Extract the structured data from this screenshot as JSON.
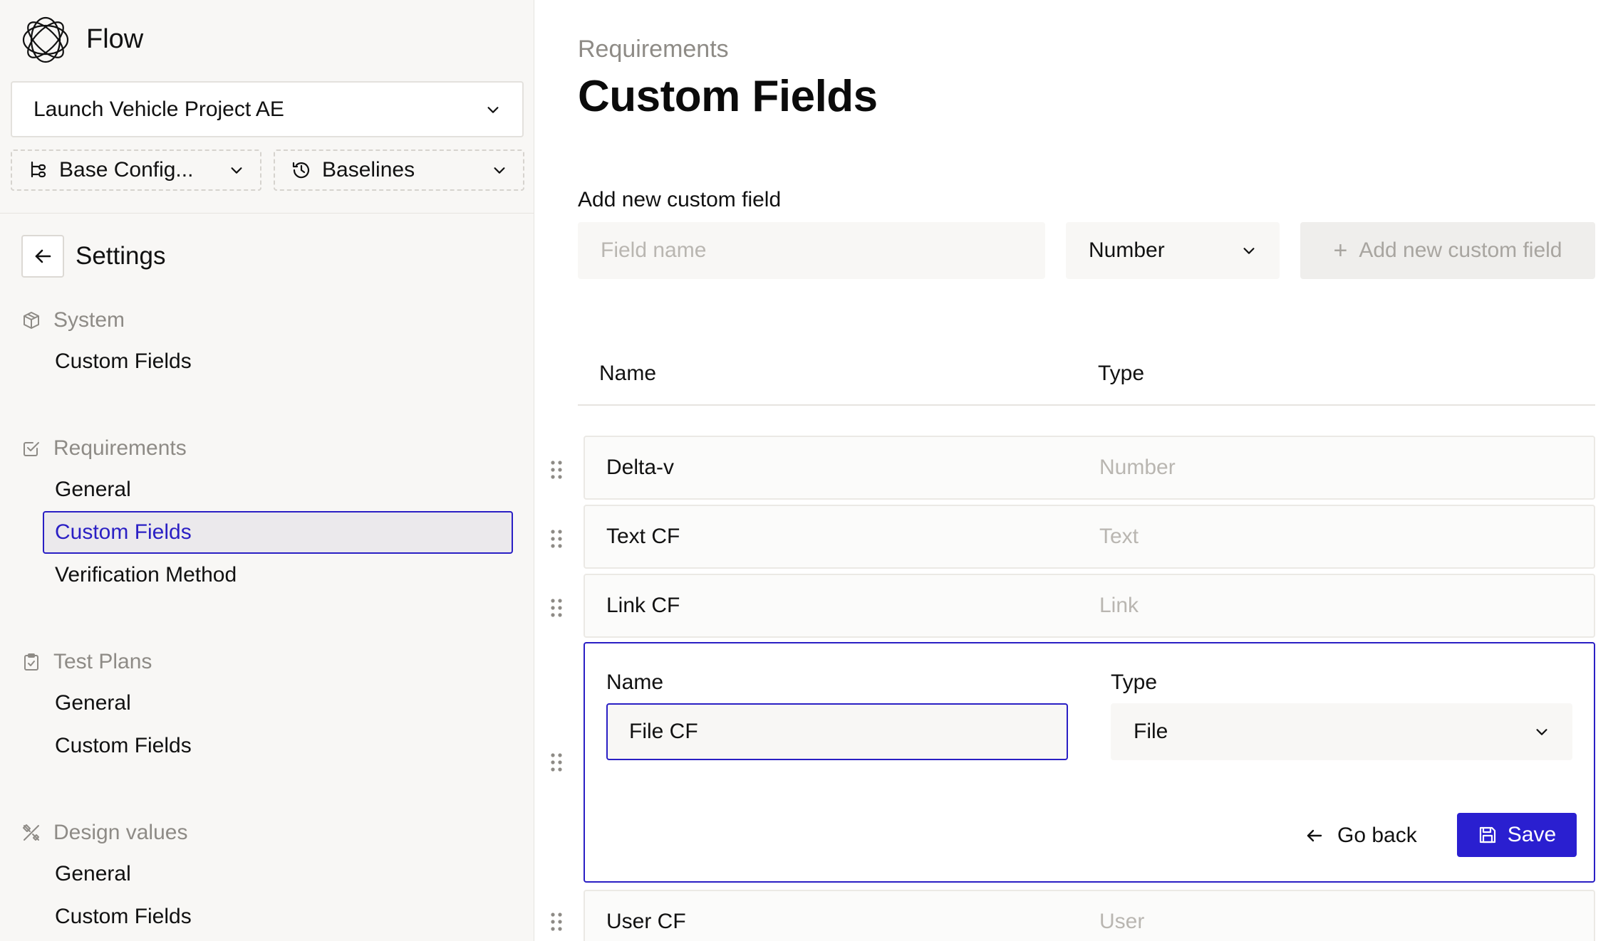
{
  "app": {
    "title": "Flow"
  },
  "sidebar": {
    "project_select": {
      "value": "Launch Vehicle Project AE"
    },
    "config_select": {
      "value": "Base Config..."
    },
    "baselines_select": {
      "value": "Baselines"
    },
    "settings_title": "Settings",
    "sections": [
      {
        "title": "System",
        "icon": "cube-icon",
        "items": [
          {
            "label": "Custom Fields",
            "active": false
          }
        ]
      },
      {
        "title": "Requirements",
        "icon": "checkbox-icon",
        "items": [
          {
            "label": "General",
            "active": false
          },
          {
            "label": "Custom Fields",
            "active": true
          },
          {
            "label": "Verification Method",
            "active": false
          }
        ]
      },
      {
        "title": "Test Plans",
        "icon": "clipboard-check-icon",
        "items": [
          {
            "label": "General",
            "active": false
          },
          {
            "label": "Custom Fields",
            "active": false
          }
        ]
      },
      {
        "title": "Design values",
        "icon": "tools-icon",
        "items": [
          {
            "label": "General",
            "active": false
          },
          {
            "label": "Custom Fields",
            "active": false
          }
        ]
      }
    ]
  },
  "main": {
    "breadcrumb": "Requirements",
    "title": "Custom Fields",
    "add_section": {
      "label": "Add new custom field",
      "field_name_placeholder": "Field name",
      "type_value": "Number",
      "add_button_label": "Add new custom field"
    },
    "table": {
      "columns": {
        "name": "Name",
        "type": "Type"
      },
      "rows": [
        {
          "name": "Delta-v",
          "type": "Number"
        },
        {
          "name": "Text CF",
          "type": "Text"
        },
        {
          "name": "Link CF",
          "type": "Link"
        }
      ],
      "editing_row": {
        "name_label": "Name",
        "type_label": "Type",
        "name_value": "File CF",
        "type_value": "File",
        "go_back_label": "Go back",
        "save_label": "Save"
      },
      "rows_after": [
        {
          "name": "User CF",
          "type": "User"
        }
      ]
    }
  },
  "colors": {
    "accent": "#2a1fc4",
    "muted_text": "#8e8b86",
    "sidebar_bg": "#f8f7f5"
  }
}
